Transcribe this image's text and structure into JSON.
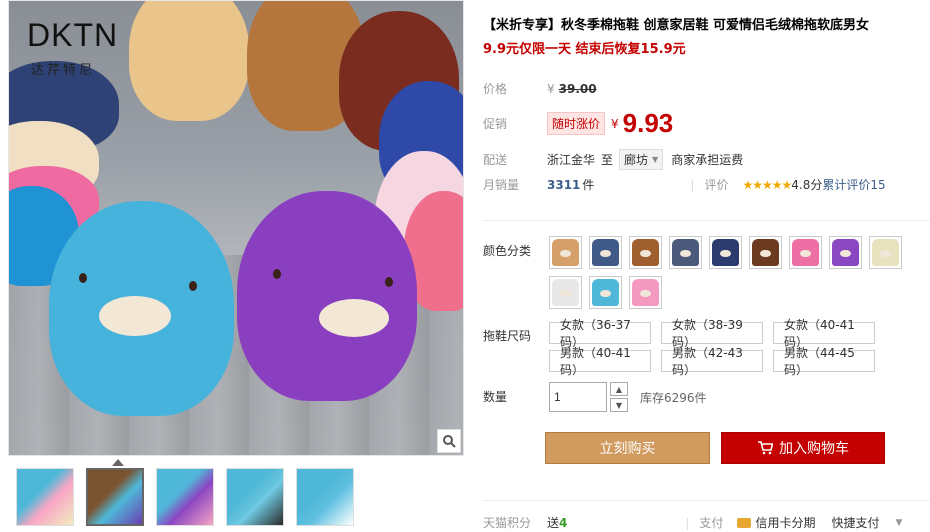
{
  "gallery": {
    "brand_logo": "DKTN",
    "brand_sub": "达芹特尼",
    "zoom_icon": "magnifier-icon",
    "thumbnails": [
      {
        "colors": [
          "#4fb8d8",
          "#f7a6c4",
          "#f2ecc0"
        ]
      },
      {
        "colors": [
          "#7a5430",
          "#4fb8d8",
          "#6a3fb1"
        ]
      },
      {
        "colors": [
          "#4fb8d8",
          "#8a47c2",
          "#f7a6c4"
        ]
      },
      {
        "colors": [
          "#4fb8d8",
          "#6fc8e0",
          "#2a2a2a"
        ]
      },
      {
        "colors": [
          "#4fb8d8",
          "#5fc0e0",
          "#ffffff"
        ]
      }
    ]
  },
  "product": {
    "title": "【米折专享】秋冬季棉拖鞋 创意家居鞋 可爱情侣毛绒棉拖软底男女",
    "promo": "9.9元仅限一天 结束后恢复15.9元"
  },
  "price": {
    "label": "价格",
    "currency": "¥",
    "original": "39.00"
  },
  "promo_price": {
    "label": "促销",
    "tag": "随时涨价",
    "currency": "¥",
    "value": "9.93"
  },
  "shipping": {
    "label": "配送",
    "from": "浙江金华",
    "to_word": "至",
    "to_city": "廊坊",
    "fee": "商家承担运费"
  },
  "sales": {
    "label": "月销量",
    "count": "3311",
    "unit": "件",
    "review_label": "评价",
    "stars": "★★★★★",
    "rating": "4.8分",
    "review_link": "累计评价15"
  },
  "color": {
    "label": "颜色分类",
    "swatches": [
      {
        "color": "#d6a06a"
      },
      {
        "color": "#3f5a86"
      },
      {
        "color": "#a05f2f"
      },
      {
        "color": "#4b5a7a"
      },
      {
        "color": "#2b3b6e"
      },
      {
        "color": "#6b3a1f"
      },
      {
        "color": "#ee6fa4"
      },
      {
        "color": "#8a47c2"
      },
      {
        "color": "#e9e2be"
      },
      {
        "color": "#e8e8e8"
      },
      {
        "color": "#4fb8d8"
      },
      {
        "color": "#f49ac1"
      }
    ]
  },
  "size": {
    "label": "拖鞋尺码",
    "options": [
      "女款（36-37码）",
      "女款（38-39码）",
      "女款（40-41码）",
      "男款（40-41码）",
      "男款（42-43码）",
      "男款（44-45码）"
    ]
  },
  "quantity": {
    "label": "数量",
    "value": "1",
    "stock": "库存6296件"
  },
  "actions": {
    "buy_now": "立刻购买",
    "add_to_cart": "加入购物车",
    "cart_icon": "cart-icon"
  },
  "footer": {
    "points_label": "天猫积分",
    "points_give": "送",
    "points_value": "4",
    "pay_label": "支付",
    "credit_card": "信用卡分期",
    "quick_pay": "快捷支付"
  }
}
